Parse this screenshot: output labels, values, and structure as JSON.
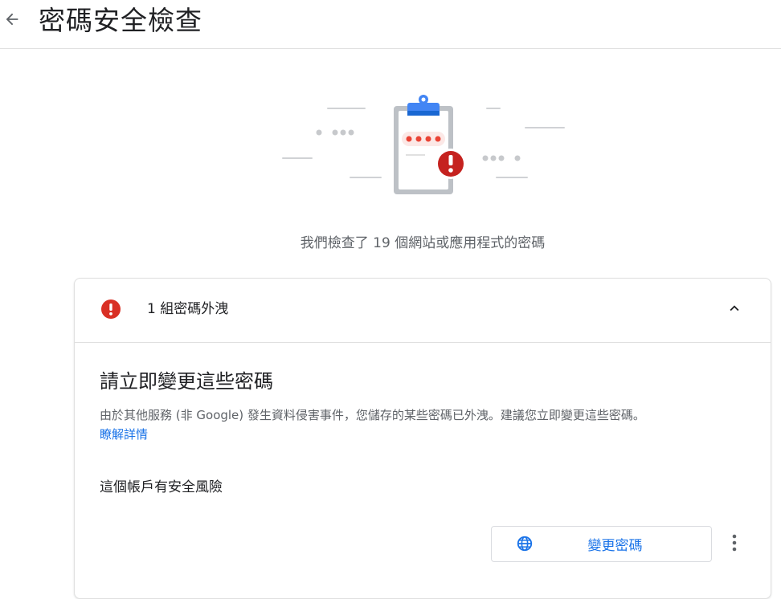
{
  "header": {
    "title": "密碼安全檢查",
    "back_icon": "arrow-back-icon"
  },
  "summary": {
    "text": "我們檢查了 19 個網站或應用程式的密碼"
  },
  "colors": {
    "alert_red": "#d93025",
    "link_blue": "#1a73e8",
    "text_secondary": "#5f6368"
  },
  "card": {
    "header_count": "1",
    "header_text": "組密碼外洩",
    "section_title": "請立即變更這些密碼",
    "description": "由於其他服務 (非 Google) 發生資料侵害事件，您儲存的某些密碼已外洩。建議您立即變更這些密碼。",
    "learn_more": "瞭解詳情",
    "account_risk": "這個帳戶有安全風險",
    "change_button": "變更密碼",
    "icons": [
      "alert-icon",
      "chevron-up-icon",
      "globe-icon",
      "more-vert-icon"
    ]
  }
}
